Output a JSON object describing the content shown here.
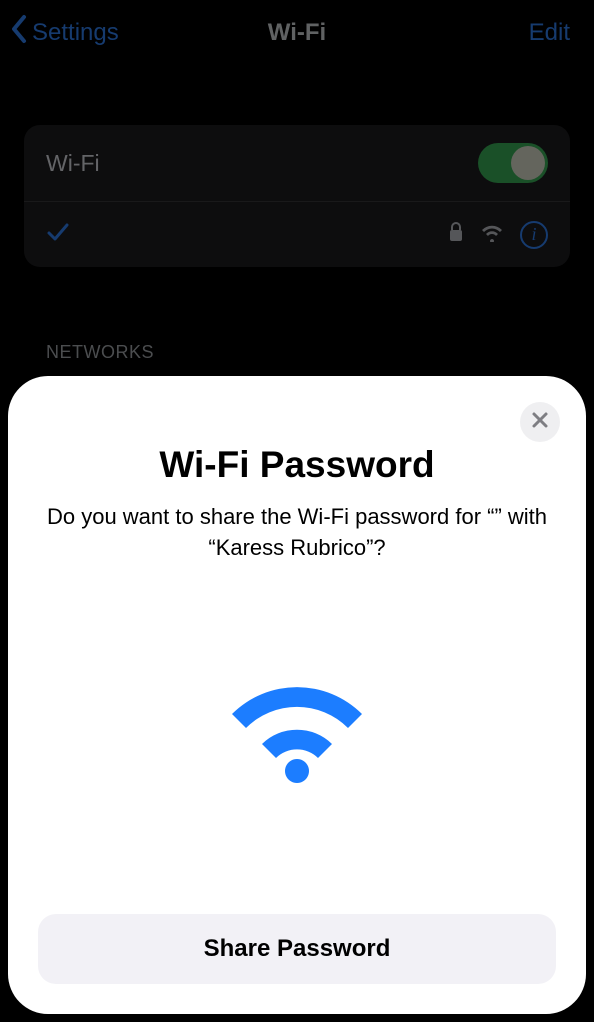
{
  "nav": {
    "back_label": "Settings",
    "title": "Wi-Fi",
    "edit_label": "Edit"
  },
  "settings": {
    "wifi_label": "Wi-Fi",
    "wifi_enabled": true,
    "section_header": "NETWORKS",
    "info_glyph": "i"
  },
  "modal": {
    "title": "Wi-Fi Password",
    "body_prefix": "Do you want to share the Wi-Fi password for “",
    "network_name": "",
    "body_mid": "” with “",
    "contact_name": "Karess Rubrico",
    "body_suffix": "”?",
    "button_label": "Share Password"
  },
  "colors": {
    "accent_blue_dim": "#163b6f",
    "accent_blue": "#1c7dff",
    "toggle_on": "#1a5028"
  }
}
